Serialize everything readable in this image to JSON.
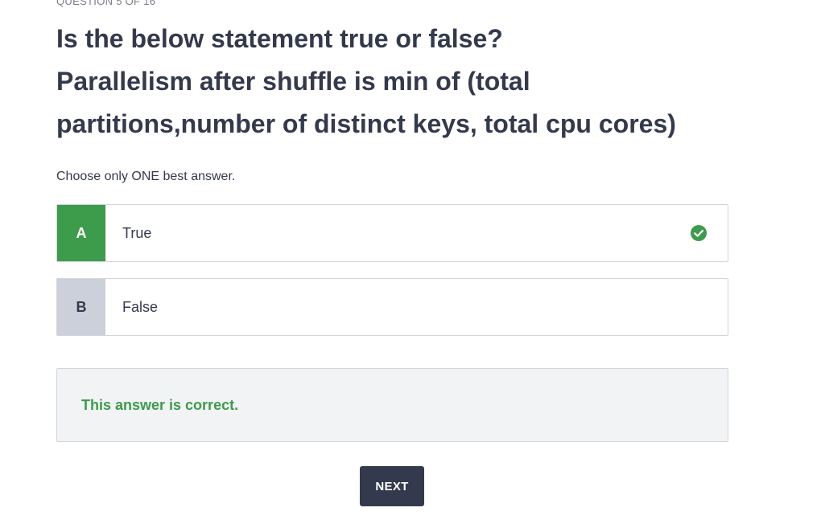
{
  "quiz": {
    "progress": "QUESTION 5 OF 16",
    "question_lines": [
      "Is the below statement true or false?",
      "Parallelism after shuffle is min of (total",
      "partitions,number of distinct keys, total cpu cores)"
    ],
    "instruction": "Choose only ONE best answer.",
    "options": [
      {
        "letter": "A",
        "text": "True",
        "selected": true,
        "correct": true,
        "icon": "check-circle-icon"
      },
      {
        "letter": "B",
        "text": "False",
        "selected": false,
        "correct": false
      }
    ],
    "feedback": "This answer is correct.",
    "next_label": "NEXT"
  },
  "colors": {
    "correct_green": "#3c9c4b",
    "dark_navy": "#333a4d",
    "option_letter_gray": "#ccd0da",
    "feedback_bg": "#f2f3f4",
    "border": "#d3d5da"
  }
}
